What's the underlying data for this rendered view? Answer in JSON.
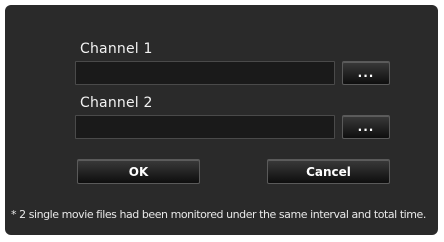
{
  "channel1": {
    "label": "Channel 1",
    "value": "",
    "browse_label": "..."
  },
  "channel2": {
    "label": "Channel 2",
    "value": "",
    "browse_label": "..."
  },
  "buttons": {
    "ok_label": "OK",
    "cancel_label": "Cancel"
  },
  "note": "* 2 single movie files had been monitored under the same interval and total time.",
  "colors": {
    "dialog_background": "#2a2a2a",
    "field_background": "#1a1a1a",
    "text": "#ffffff"
  },
  "icons": {
    "browse": "ellipsis-icon"
  }
}
